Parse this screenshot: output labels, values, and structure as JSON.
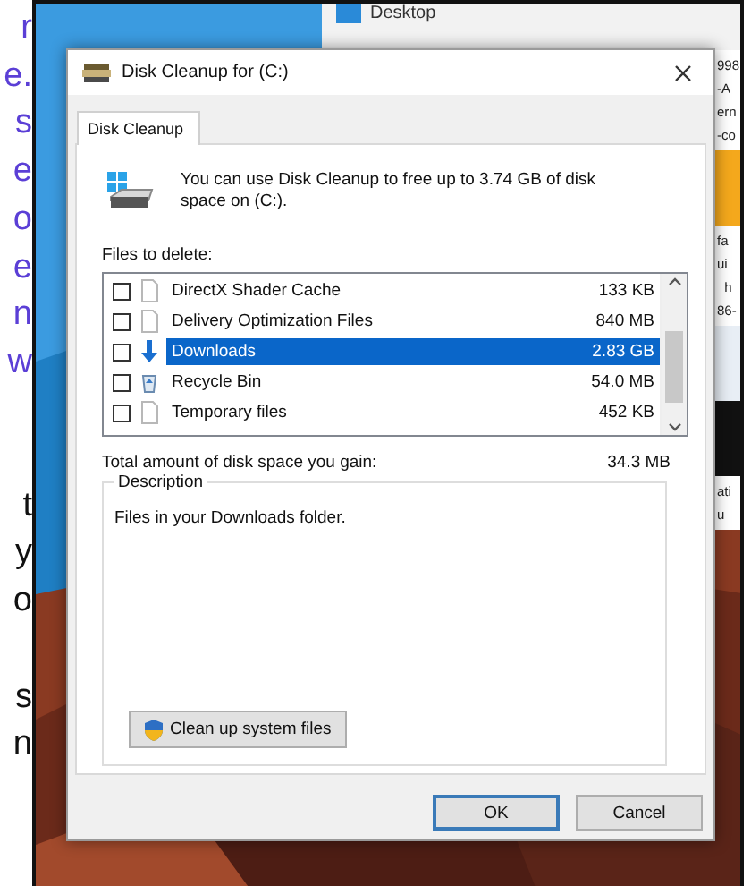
{
  "article_text": {
    "paragraphs": [
      {
        "color": "#5b3fd6",
        "lines": [
          "r",
          "e.",
          "s",
          "e",
          "o",
          "e",
          "n",
          "w"
        ]
      },
      {
        "color": "#111111",
        "lines": [
          "t",
          "y",
          "o"
        ]
      },
      {
        "color": "#111111",
        "lines": [
          "s",
          "n"
        ]
      }
    ]
  },
  "background_window": {
    "title": "Desktop",
    "side_text_groups": [
      [
        "998",
        "-A",
        "ern",
        "-co"
      ],
      [
        "fa",
        "ui",
        "_h",
        "86-"
      ],
      [
        "ati",
        "u"
      ]
    ]
  },
  "dialog": {
    "title": "Disk Cleanup for (C:)",
    "tabs": [
      {
        "label": "Disk Cleanup",
        "selected": true
      }
    ],
    "intro": "You can use Disk Cleanup to free up to 3.74 GB of disk space on (C:).",
    "files_label": "Files to delete:",
    "files": [
      {
        "name": "DirectX Shader Cache",
        "size": "133 KB",
        "kind": "file",
        "checked": false,
        "selected": false
      },
      {
        "name": "Delivery Optimization Files",
        "size": "840 MB",
        "kind": "file",
        "checked": false,
        "selected": false
      },
      {
        "name": "Downloads",
        "size": "2.83 GB",
        "kind": "download",
        "checked": false,
        "selected": true
      },
      {
        "name": "Recycle Bin",
        "size": "54.0 MB",
        "kind": "recycle",
        "checked": false,
        "selected": false
      },
      {
        "name": "Temporary files",
        "size": "452 KB",
        "kind": "file",
        "checked": false,
        "selected": false
      }
    ],
    "total_label": "Total amount of disk space you gain:",
    "total_value": "34.3 MB",
    "description_label": "Description",
    "description": "Files in your Downloads folder.",
    "system_button": "Clean up system files",
    "buttons": [
      {
        "label": "OK",
        "default": true
      },
      {
        "label": "Cancel",
        "default": false
      }
    ]
  }
}
